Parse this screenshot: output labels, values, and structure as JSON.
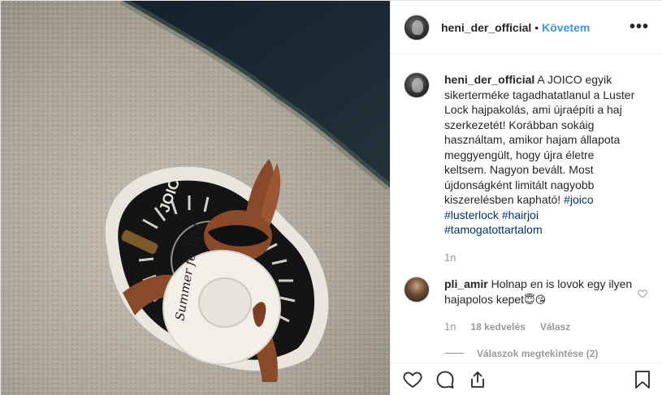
{
  "header": {
    "username": "heni_der_official",
    "dot": "•",
    "follow_label": "Követem",
    "more_icon": "more-horizontal-icon"
  },
  "caption": {
    "username": "heni_der_official",
    "text": "A JOICO egyik sikerterméke tagadhatatlanul a Luster Lock hajpakolás, ami újraépíti a haj szerkezetét! Korábban sokáig használtam, amikor hajam állapota meggyengült, hogy újra életre keltsem. Nagyon bevált. Most újdonságként limitált nagyobb kiszerelésben kapható!",
    "hashtags": [
      "#joico",
      "#lusterlock",
      "#hairjoi",
      "#tamogatottartalom"
    ],
    "time": "1n"
  },
  "comment": {
    "username": "pli_amir",
    "text": "Holnap en is lovok egy ilyen hajapolos kepet",
    "emojis": "😇😘",
    "time": "1n",
    "likes": "18 kedvelés",
    "reply_label": "Válasz",
    "view_replies": "Válaszok megtekintése (2)"
  },
  "actions": {
    "like_icon": "heart-icon",
    "comment_icon": "comment-icon",
    "share_icon": "share-icon",
    "save_icon": "bookmark-icon"
  },
  "photo": {
    "hat_text": "Summer feeling",
    "towel_text": "JOICO"
  },
  "colors": {
    "link_blue": "#3897f0",
    "hashtag": "#003569",
    "muted": "#999999",
    "border": "#efefef"
  }
}
